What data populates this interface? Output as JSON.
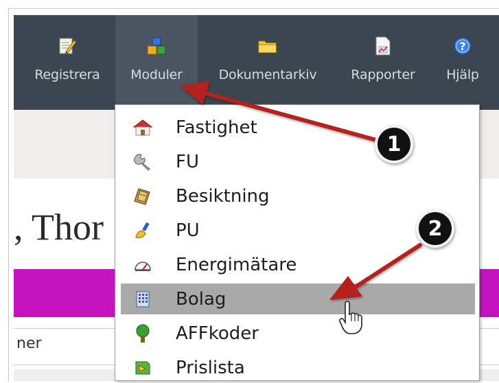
{
  "toolbar": {
    "items": [
      {
        "label": "Registrera",
        "icon": "notepad-pencil-icon"
      },
      {
        "label": "Moduler",
        "icon": "blocks-icon"
      },
      {
        "label": "Dokumentarkiv",
        "icon": "folder-icon"
      },
      {
        "label": "Rapporter",
        "icon": "report-chart-icon"
      },
      {
        "label": "Hjälp",
        "icon": "help-icon"
      }
    ],
    "colors": {
      "background": "#3b4651",
      "active": "#4a5561",
      "text": "#d7dde2"
    }
  },
  "page": {
    "heading": ", Thor",
    "input_fragment": "ner",
    "accent_color": "#c414c0"
  },
  "dropdown": {
    "items": [
      {
        "label": "Fastighet",
        "icon": "house-icon"
      },
      {
        "label": "FU",
        "icon": "wrench-icon"
      },
      {
        "label": "Besiktning",
        "icon": "book-icon"
      },
      {
        "label": "PU",
        "icon": "paintbrush-icon"
      },
      {
        "label": "Energimätare",
        "icon": "gauge-icon"
      },
      {
        "label": "Bolag",
        "icon": "building-icon",
        "highlighted": true
      },
      {
        "label": "AFFkoder",
        "icon": "tree-icon"
      },
      {
        "label": "Prislista",
        "icon": "pricelist-icon"
      }
    ]
  },
  "annotations": {
    "badge_1": "1",
    "badge_2": "2",
    "arrow_color": "#b3201c"
  }
}
